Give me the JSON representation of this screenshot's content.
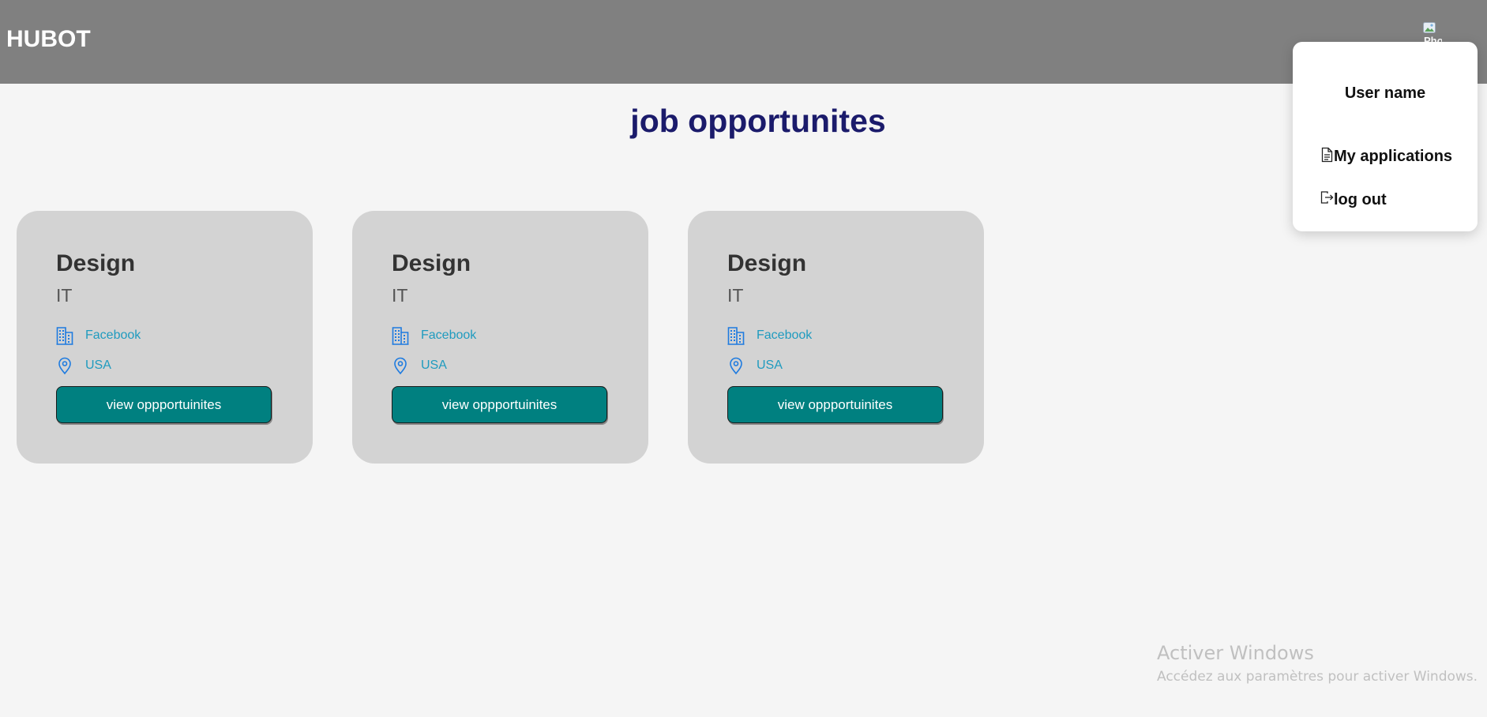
{
  "header": {
    "brand": "HUBOT",
    "avatar_alt": "Phot"
  },
  "main": {
    "title": "job opportunites",
    "cards": [
      {
        "title": "Design",
        "department": "IT",
        "company": "Facebook",
        "location": "USA",
        "button_label": "view oppportuinites"
      },
      {
        "title": "Design",
        "department": "IT",
        "company": "Facebook",
        "location": "USA",
        "button_label": "view oppportuinites"
      },
      {
        "title": "Design",
        "department": "IT",
        "company": "Facebook",
        "location": "USA",
        "button_label": "view oppportuinites"
      }
    ]
  },
  "dropdown": {
    "user_name": "User name",
    "items": [
      {
        "label": "My applications",
        "icon": "document-icon"
      },
      {
        "label": "log out",
        "icon": "logout-icon"
      }
    ]
  },
  "watermark": {
    "title": "Activer Windows",
    "subtitle": "Accédez aux paramètres pour activer Windows."
  },
  "colors": {
    "header_bg": "#808080",
    "page_bg": "#f5f5f5",
    "card_bg": "#d3d3d3",
    "title": "#1b1b6b",
    "button_bg": "#008080",
    "info_text": "#1f9bbf",
    "icon_blue": "#1e7be0"
  }
}
